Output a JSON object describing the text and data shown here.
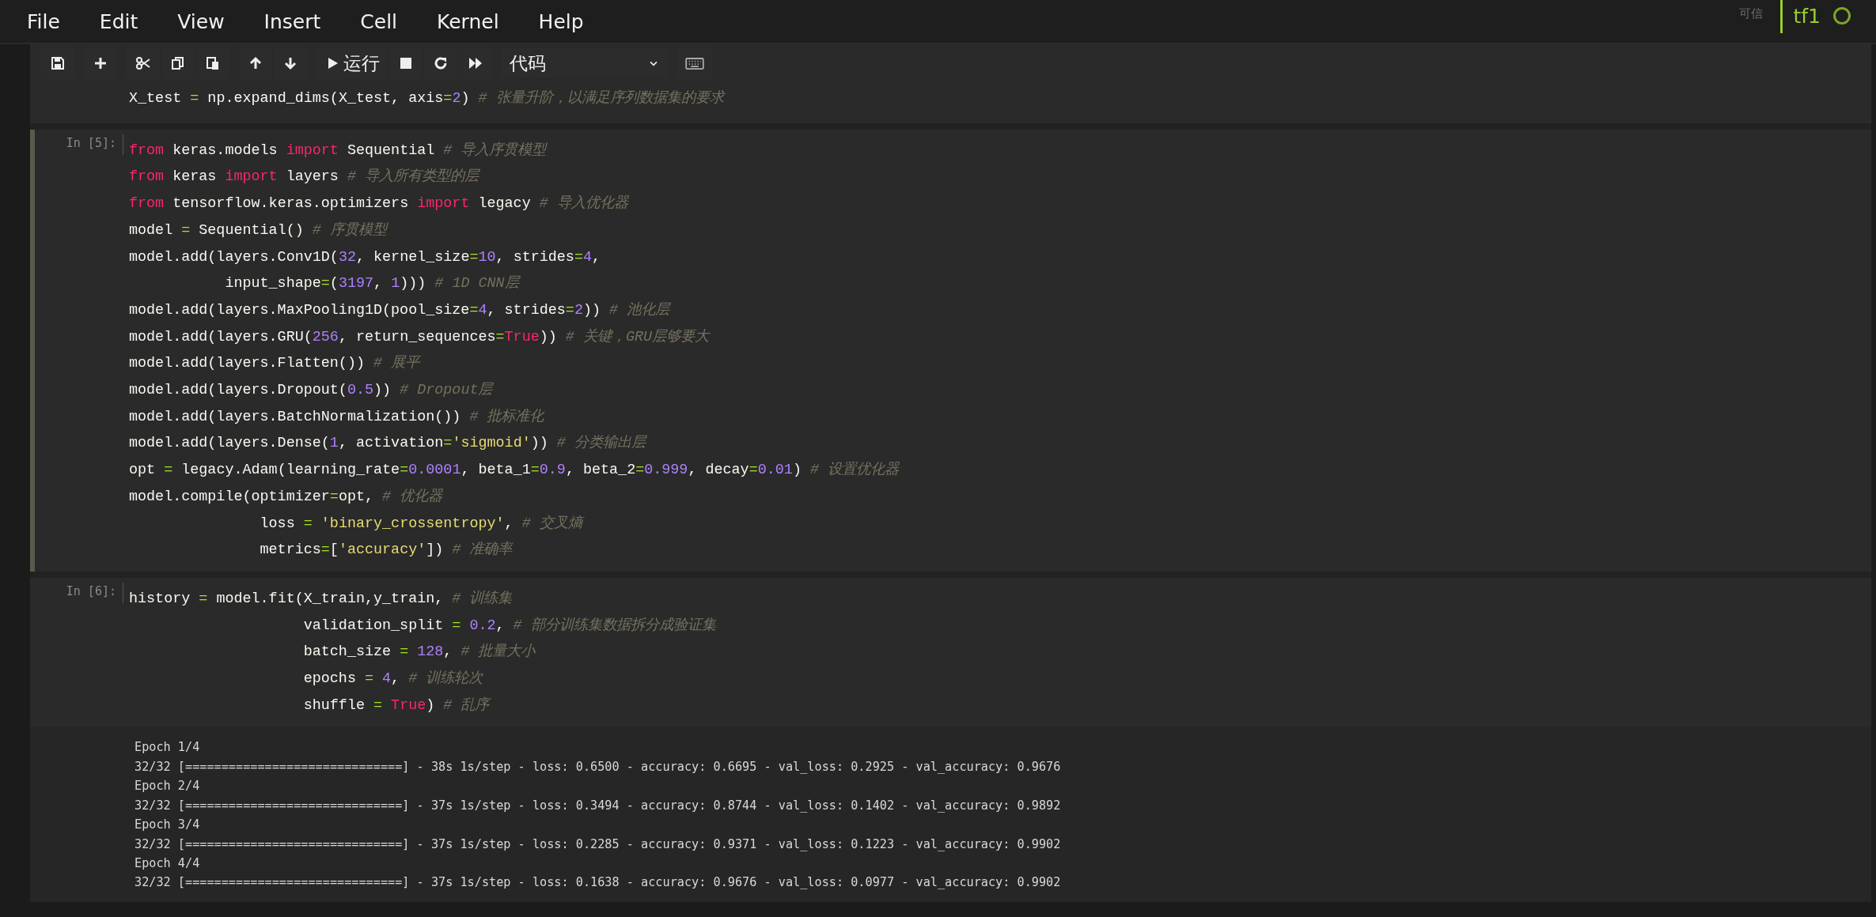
{
  "menu": [
    "File",
    "Edit",
    "View",
    "Insert",
    "Cell",
    "Kernel",
    "Help"
  ],
  "kernel": {
    "trust": "可信",
    "name": "tf1",
    "busy": false
  },
  "toolbar": {
    "run_label": "运行",
    "cell_type": "代码"
  },
  "cells": [
    {
      "selected": false,
      "lines": [
        [
          {
            "kind": "plain",
            "text": "X_test "
          },
          {
            "kind": "op",
            "text": "="
          },
          {
            "kind": "plain",
            "text": " np.expand_dims(X_test, axis"
          },
          {
            "kind": "op",
            "text": "="
          },
          {
            "kind": "num",
            "text": "2"
          },
          {
            "kind": "plain",
            "text": ") "
          },
          {
            "kind": "comment",
            "text": "# 张量升阶，以满足序列数据集的要求"
          }
        ]
      ]
    },
    {
      "selected": true,
      "prompt": "In [5]:",
      "lines": [
        [
          {
            "kind": "kw",
            "text": "from"
          },
          {
            "kind": "plain",
            "text": " keras.models "
          },
          {
            "kind": "kw",
            "text": "import"
          },
          {
            "kind": "plain",
            "text": " Sequential "
          },
          {
            "kind": "comment",
            "text": "# 导入序贯模型"
          }
        ],
        [
          {
            "kind": "kw",
            "text": "from"
          },
          {
            "kind": "plain",
            "text": " keras "
          },
          {
            "kind": "kw",
            "text": "import"
          },
          {
            "kind": "plain",
            "text": " layers "
          },
          {
            "kind": "comment",
            "text": "# 导入所有类型的层"
          }
        ],
        [
          {
            "kind": "kw",
            "text": "from"
          },
          {
            "kind": "plain",
            "text": " tensorflow.keras.optimizers "
          },
          {
            "kind": "kw",
            "text": "import"
          },
          {
            "kind": "plain",
            "text": " legacy "
          },
          {
            "kind": "comment",
            "text": "# 导入优化器"
          }
        ],
        [
          {
            "kind": "plain",
            "text": "model "
          },
          {
            "kind": "op",
            "text": "="
          },
          {
            "kind": "plain",
            "text": " Sequential() "
          },
          {
            "kind": "comment",
            "text": "# 序贯模型"
          }
        ],
        [
          {
            "kind": "plain",
            "text": "model.add(layers.Conv1D("
          },
          {
            "kind": "num",
            "text": "32"
          },
          {
            "kind": "plain",
            "text": ", kernel_size"
          },
          {
            "kind": "op",
            "text": "="
          },
          {
            "kind": "num",
            "text": "10"
          },
          {
            "kind": "plain",
            "text": ", strides"
          },
          {
            "kind": "op",
            "text": "="
          },
          {
            "kind": "num",
            "text": "4"
          },
          {
            "kind": "plain",
            "text": ","
          }
        ],
        [
          {
            "kind": "plain",
            "text": "           input_shape"
          },
          {
            "kind": "op",
            "text": "="
          },
          {
            "kind": "plain",
            "text": "("
          },
          {
            "kind": "num",
            "text": "3197"
          },
          {
            "kind": "plain",
            "text": ", "
          },
          {
            "kind": "num",
            "text": "1"
          },
          {
            "kind": "plain",
            "text": "))) "
          },
          {
            "kind": "comment",
            "text": "# 1D CNN层"
          }
        ],
        [
          {
            "kind": "plain",
            "text": "model.add(layers.MaxPooling1D(pool_size"
          },
          {
            "kind": "op",
            "text": "="
          },
          {
            "kind": "num",
            "text": "4"
          },
          {
            "kind": "plain",
            "text": ", strides"
          },
          {
            "kind": "op",
            "text": "="
          },
          {
            "kind": "num",
            "text": "2"
          },
          {
            "kind": "plain",
            "text": ")) "
          },
          {
            "kind": "comment",
            "text": "# 池化层"
          }
        ],
        [
          {
            "kind": "plain",
            "text": "model.add(layers.GRU("
          },
          {
            "kind": "num",
            "text": "256"
          },
          {
            "kind": "plain",
            "text": ", return_sequences"
          },
          {
            "kind": "op",
            "text": "="
          },
          {
            "kind": "kw",
            "text": "True"
          },
          {
            "kind": "plain",
            "text": ")) "
          },
          {
            "kind": "comment",
            "text": "# 关键，GRU层够要大"
          }
        ],
        [
          {
            "kind": "plain",
            "text": "model.add(layers.Flatten()) "
          },
          {
            "kind": "comment",
            "text": "# 展平"
          }
        ],
        [
          {
            "kind": "plain",
            "text": "model.add(layers.Dropout("
          },
          {
            "kind": "num",
            "text": "0.5"
          },
          {
            "kind": "plain",
            "text": ")) "
          },
          {
            "kind": "comment",
            "text": "# Dropout层"
          }
        ],
        [
          {
            "kind": "plain",
            "text": "model.add(layers.BatchNormalization()) "
          },
          {
            "kind": "comment",
            "text": "# 批标准化"
          }
        ],
        [
          {
            "kind": "plain",
            "text": "model.add(layers.Dense("
          },
          {
            "kind": "num",
            "text": "1"
          },
          {
            "kind": "plain",
            "text": ", activation"
          },
          {
            "kind": "op",
            "text": "="
          },
          {
            "kind": "str",
            "text": "'sigmoid'"
          },
          {
            "kind": "plain",
            "text": ")) "
          },
          {
            "kind": "comment",
            "text": "# 分类输出层"
          }
        ],
        [
          {
            "kind": "plain",
            "text": "opt "
          },
          {
            "kind": "op",
            "text": "="
          },
          {
            "kind": "plain",
            "text": " legacy.Adam(learning_rate"
          },
          {
            "kind": "op",
            "text": "="
          },
          {
            "kind": "num",
            "text": "0.0001"
          },
          {
            "kind": "plain",
            "text": ", beta_1"
          },
          {
            "kind": "op",
            "text": "="
          },
          {
            "kind": "num",
            "text": "0.9"
          },
          {
            "kind": "plain",
            "text": ", beta_2"
          },
          {
            "kind": "op",
            "text": "="
          },
          {
            "kind": "num",
            "text": "0.999"
          },
          {
            "kind": "plain",
            "text": ", decay"
          },
          {
            "kind": "op",
            "text": "="
          },
          {
            "kind": "num",
            "text": "0.01"
          },
          {
            "kind": "plain",
            "text": ") "
          },
          {
            "kind": "comment",
            "text": "# 设置优化器"
          }
        ],
        [
          {
            "kind": "plain",
            "text": "model.compile(optimizer"
          },
          {
            "kind": "op",
            "text": "="
          },
          {
            "kind": "plain",
            "text": "opt, "
          },
          {
            "kind": "comment",
            "text": "# 优化器"
          }
        ],
        [
          {
            "kind": "plain",
            "text": "               loss "
          },
          {
            "kind": "op",
            "text": "= "
          },
          {
            "kind": "str",
            "text": "'binary_crossentropy'"
          },
          {
            "kind": "plain",
            "text": ", "
          },
          {
            "kind": "comment",
            "text": "# 交叉熵"
          }
        ],
        [
          {
            "kind": "plain",
            "text": "               metrics"
          },
          {
            "kind": "op",
            "text": "="
          },
          {
            "kind": "plain",
            "text": "["
          },
          {
            "kind": "str",
            "text": "'accuracy'"
          },
          {
            "kind": "plain",
            "text": "]) "
          },
          {
            "kind": "comment",
            "text": "# 准确率"
          }
        ]
      ]
    },
    {
      "selected": false,
      "prompt": "In [6]:",
      "lines": [
        [
          {
            "kind": "plain",
            "text": "history "
          },
          {
            "kind": "op",
            "text": "="
          },
          {
            "kind": "plain",
            "text": " model.fit(X_train,y_train, "
          },
          {
            "kind": "comment",
            "text": "# 训练集"
          }
        ],
        [
          {
            "kind": "plain",
            "text": "                    validation_split "
          },
          {
            "kind": "op",
            "text": "= "
          },
          {
            "kind": "num",
            "text": "0.2"
          },
          {
            "kind": "plain",
            "text": ", "
          },
          {
            "kind": "comment",
            "text": "# 部分训练集数据拆分成验证集"
          }
        ],
        [
          {
            "kind": "plain",
            "text": "                    batch_size "
          },
          {
            "kind": "op",
            "text": "= "
          },
          {
            "kind": "num",
            "text": "128"
          },
          {
            "kind": "plain",
            "text": ", "
          },
          {
            "kind": "comment",
            "text": "# 批量大小"
          }
        ],
        [
          {
            "kind": "plain",
            "text": "                    epochs "
          },
          {
            "kind": "op",
            "text": "= "
          },
          {
            "kind": "num",
            "text": "4"
          },
          {
            "kind": "plain",
            "text": ", "
          },
          {
            "kind": "comment",
            "text": "# 训练轮次"
          }
        ],
        [
          {
            "kind": "plain",
            "text": "                    shuffle "
          },
          {
            "kind": "op",
            "text": "= "
          },
          {
            "kind": "kw",
            "text": "True"
          },
          {
            "kind": "plain",
            "text": ") "
          },
          {
            "kind": "comment",
            "text": "# 乱序"
          }
        ]
      ],
      "output": [
        "Epoch 1/4",
        "32/32 [==============================] - 38s 1s/step - loss: 0.6500 - accuracy: 0.6695 - val_loss: 0.2925 - val_accuracy: 0.9676",
        "Epoch 2/4",
        "32/32 [==============================] - 37s 1s/step - loss: 0.3494 - accuracy: 0.8744 - val_loss: 0.1402 - val_accuracy: 0.9892",
        "Epoch 3/4",
        "32/32 [==============================] - 37s 1s/step - loss: 0.2285 - accuracy: 0.9371 - val_loss: 0.1223 - val_accuracy: 0.9902",
        "Epoch 4/4",
        "32/32 [==============================] - 37s 1s/step - loss: 0.1638 - accuracy: 0.9676 - val_loss: 0.0977 - val_accuracy: 0.9902"
      ]
    }
  ]
}
